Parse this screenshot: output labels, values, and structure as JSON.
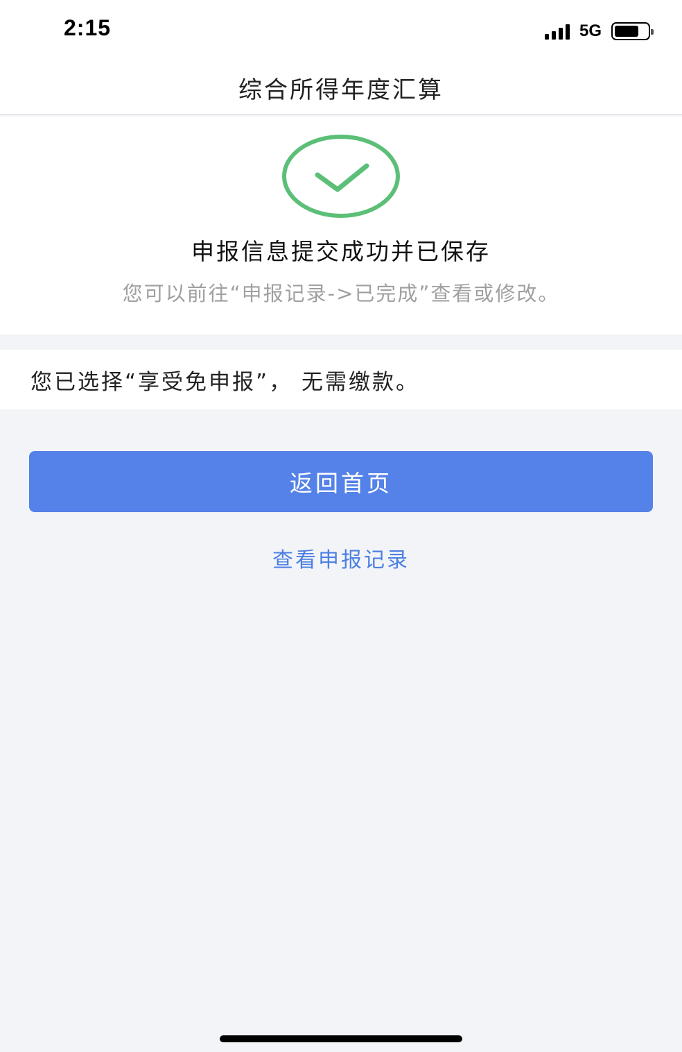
{
  "status_bar": {
    "time": "2:15",
    "network": "5G",
    "icons": [
      "signal-icon",
      "battery-icon"
    ]
  },
  "header": {
    "title": "综合所得年度汇算"
  },
  "result": {
    "icon": "check-circle-icon",
    "icon_color": "#5cbf78",
    "title": "申报信息提交成功并已保存",
    "hint": "您可以前往“申报记录->已完成”查看或修改。"
  },
  "notice": {
    "text": "您已选择“享受免申报”， 无需缴款。"
  },
  "actions": {
    "home_label": "返回首页",
    "records_label": "查看申报记录"
  },
  "colors": {
    "primary": "#5582e8",
    "link": "#4d7fe2",
    "background": "#f2f4f8",
    "success": "#5cbf78"
  }
}
